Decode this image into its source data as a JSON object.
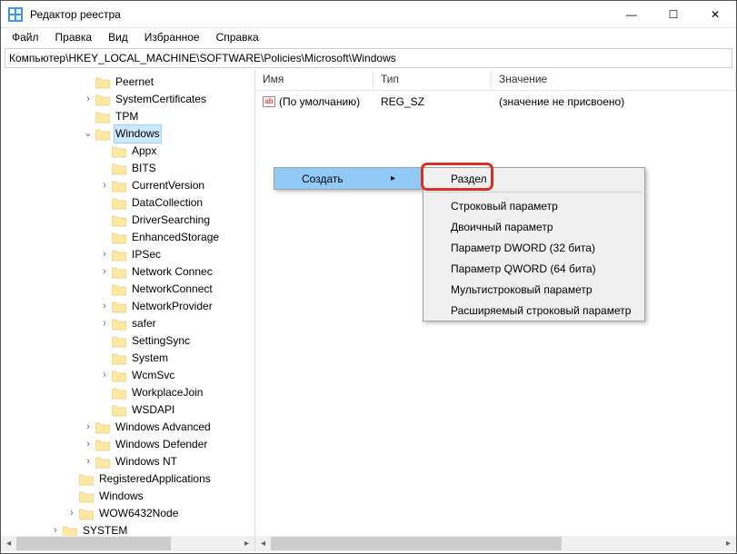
{
  "window": {
    "title": "Редактор реестра",
    "btn_min": "—",
    "btn_max": "☐",
    "btn_close": "✕"
  },
  "menu": {
    "file": "Файл",
    "edit": "Правка",
    "view": "Вид",
    "fav": "Избранное",
    "help": "Справка"
  },
  "address": "Компьютер\\HKEY_LOCAL_MACHINE\\SOFTWARE\\Policies\\Microsoft\\Windows",
  "columns": {
    "name": "Имя",
    "type": "Тип",
    "value": "Значение"
  },
  "row": {
    "name": "(По умолчанию)",
    "type": "REG_SZ",
    "value": "(значение не присвоено)"
  },
  "tree": {
    "peernet": "Peernet",
    "syscert": "SystemCertificates",
    "tpm": "TPM",
    "windows": "Windows",
    "appx": "Appx",
    "bits": "BITS",
    "curver": "CurrentVersion",
    "datacol": "DataCollection",
    "drvsearch": "DriverSearching",
    "enhstor": "EnhancedStorage",
    "ipsec": "IPSec",
    "netconn1": "Network Connec",
    "netconn2": "NetworkConnect",
    "netprov": "NetworkProvider",
    "safer": "safer",
    "settingsync": "SettingSync",
    "system": "System",
    "wcmsvc": "WcmSvc",
    "workplace": "WorkplaceJoin",
    "wsdapi": "WSDAPI",
    "winadv": "Windows Advanced",
    "windef": "Windows Defender",
    "winnt": "Windows NT",
    "regapps": "RegisteredApplications",
    "windows2": "Windows",
    "wow64": "WOW6432Node",
    "systemroot": "SYSTEM"
  },
  "ctx": {
    "create": "Создать",
    "section": "Раздел",
    "strparam": "Строковый параметр",
    "binparam": "Двоичный параметр",
    "dword": "Параметр DWORD (32 бита)",
    "qword": "Параметр QWORD (64 бита)",
    "multistr": "Мультистроковый параметр",
    "expstr": "Расширяемый строковый параметр"
  }
}
